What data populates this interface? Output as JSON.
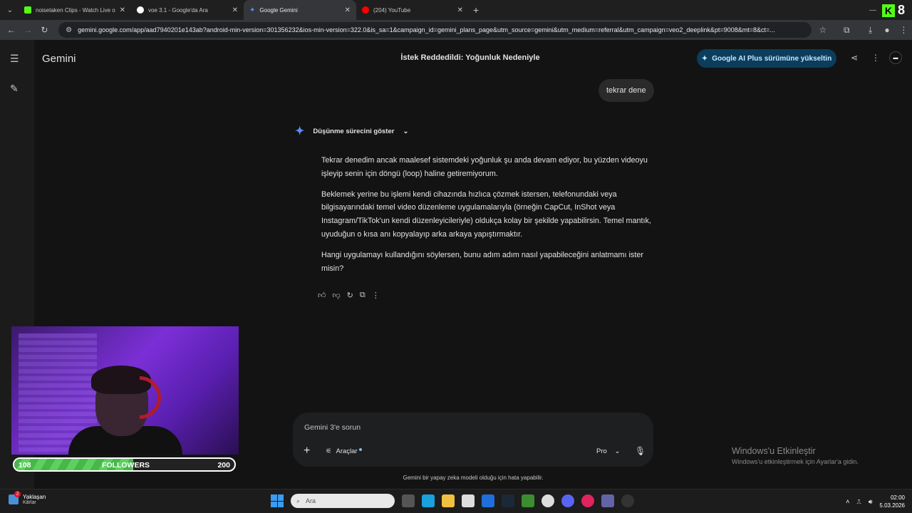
{
  "browser": {
    "tabs": [
      {
        "title": "noisetaken Clips - Watch Live o",
        "favicon_color": "#53fc18"
      },
      {
        "title": "voe 3.1 - Google'da Ara",
        "favicon_color": "#ffffff"
      },
      {
        "title": "Google Gemini",
        "favicon_color": "#5b8def",
        "active": true
      },
      {
        "title": "(204) YouTube",
        "favicon_color": "#ff0000"
      }
    ],
    "kick_count": "8",
    "url": "gemini.google.com/app/aad7940201e143ab?android-min-version=301356232&ios-min-version=322.0&is_sa=1&campaign_id=gemini_plans_page&utm_source=gemini&utm_medium=referral&utm_campaign=veo2_deeplink&pt=9008&mt=8&ct=..."
  },
  "header": {
    "app_name": "Gemini",
    "conversation_title": "İstek Reddedildi: Yoğunluk Nedeniyle",
    "upgrade_label": "Google AI Plus sürümüne yükseltin"
  },
  "chat": {
    "user_message": "tekrar dene",
    "thinking_label": "Düşünme sürecini göster",
    "response_paragraphs": [
      "Tekrar denedim ancak maalesef sistemdeki yoğunluk şu anda devam ediyor, bu yüzden videoyu işleyip senin için döngü (loop) haline getiremiyorum.",
      "Beklemek yerine bu işlemi kendi cihazında hızlıca çözmek istersen, telefonundaki veya bilgisayarındaki temel video düzenleme uygulamalarıyla (örneğin CapCut, InShot veya Instagram/TikTok'un kendi düzenleyicileriyle) oldukça kolay bir şekilde yapabilirsin. Temel mantık, uyuduğun o kısa anı kopyalayıp arka arkaya yapıştırmaktır.",
      "Hangi uygulamayı kullandığını söylersen, bunu adım adım nasıl yapabileceğini anlatmamı ister misin?"
    ]
  },
  "composer": {
    "placeholder": "Gemini 3'e sorun",
    "tools_label": "Araçlar",
    "model_label": "Pro",
    "disclaimer": "Gemini bir yapay zeka modeli olduğu için hata yapabilir."
  },
  "windows_activation": {
    "title": "Windows'u Etkinleştir",
    "subtitle": "Windows'u etkinleştirmek için Ayarlar'a gidin."
  },
  "overlay": {
    "followers_current": "108",
    "followers_label": "FOLLOWERS",
    "followers_goal": "200",
    "progress_fraction": 0.54
  },
  "taskbar": {
    "weather_title": "Yaklaşan",
    "weather_subtitle": "Kârlar",
    "weather_badge": "2",
    "search_placeholder": "Ara",
    "time": "02:00",
    "date": "5.03.2026"
  }
}
